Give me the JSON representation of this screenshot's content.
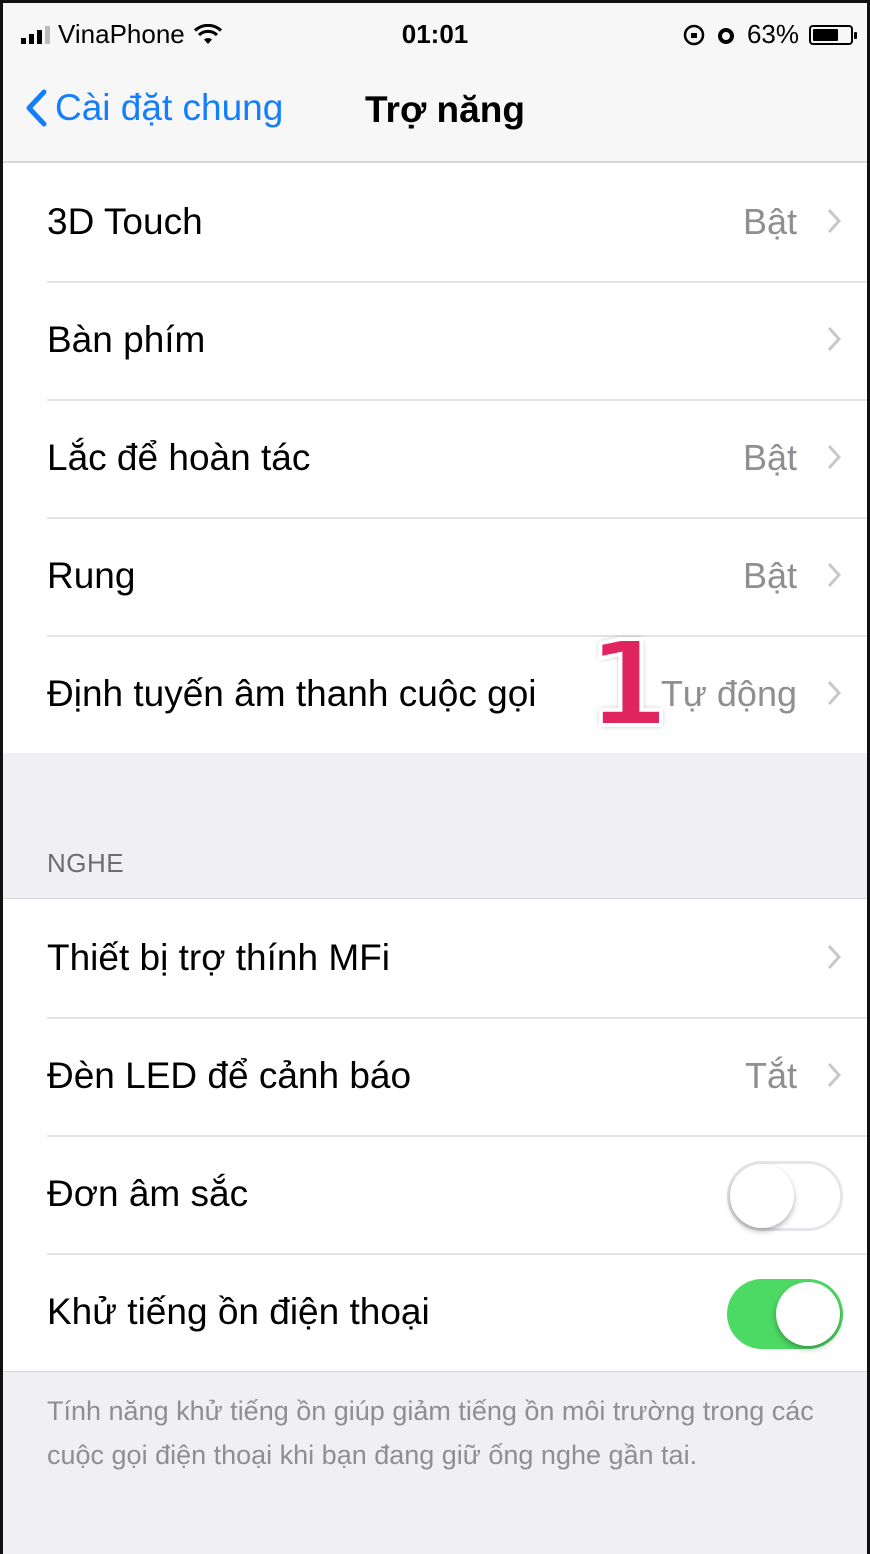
{
  "status_bar": {
    "carrier": "VinaPhone",
    "time": "01:01",
    "battery_percent": "63%",
    "battery_level": 0.63
  },
  "nav": {
    "back_label": "Cài đặt chung",
    "title": "Trợ năng"
  },
  "group1": [
    {
      "label": "3D Touch",
      "value": "Bật"
    },
    {
      "label": "Bàn phím",
      "value": ""
    },
    {
      "label": "Lắc để hoàn tác",
      "value": "Bật"
    },
    {
      "label": "Rung",
      "value": "Bật"
    },
    {
      "label": "Định tuyến âm thanh cuộc gọi",
      "value": "Tự động"
    }
  ],
  "section_hearing": {
    "header": "NGHE",
    "rows": [
      {
        "label": "Thiết bị trợ thính MFi",
        "value": ""
      },
      {
        "label": "Đèn LED để cảnh báo",
        "value": "Tắt"
      },
      {
        "label": "Đơn âm sắc",
        "toggle": "off"
      },
      {
        "label": "Khử tiếng ồn điện thoại",
        "toggle": "on"
      }
    ]
  },
  "footer_text": "Tính năng khử tiếng ồn giúp giảm tiếng ồn môi trường trong các cuộc gọi điện thoại khi bạn đang giữ ống nghe gần tai.",
  "annotation": "1",
  "colors": {
    "accent": "#147efb",
    "toggle_on": "#4cd964",
    "annotation": "#e0245e"
  }
}
